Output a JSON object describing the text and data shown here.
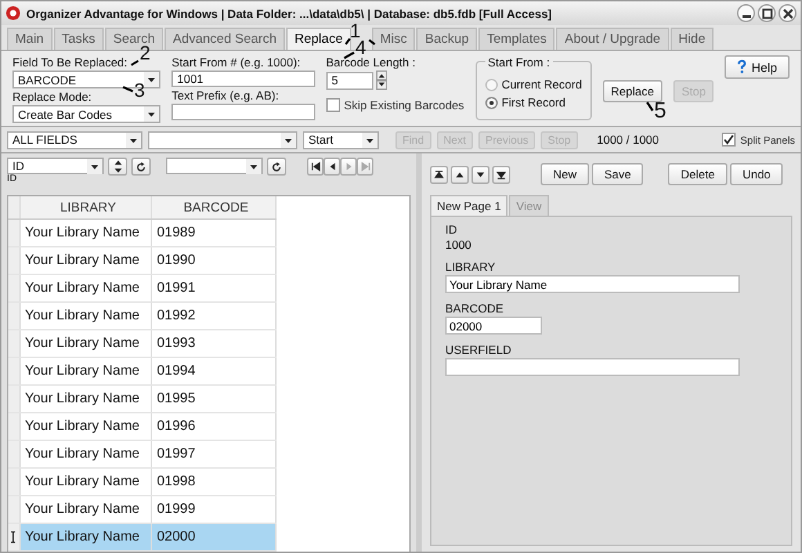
{
  "window": {
    "title": "Organizer Advantage for Windows | Data Folder: ...\\data\\db5\\ | Database: db5.fdb [Full Access]"
  },
  "tabs": [
    {
      "label": "Main",
      "selected": false
    },
    {
      "label": "Tasks",
      "selected": false
    },
    {
      "label": "Search",
      "selected": false
    },
    {
      "label": "Advanced Search",
      "selected": false
    },
    {
      "label": "Replace",
      "selected": true
    },
    {
      "label": "Misc",
      "selected": false
    },
    {
      "label": "Backup",
      "selected": false
    },
    {
      "label": "Templates",
      "selected": false
    },
    {
      "label": "About / Upgrade",
      "selected": false
    },
    {
      "label": "Hide",
      "selected": false
    }
  ],
  "replace_panel": {
    "field_label": "Field To Be Replaced:",
    "field_value": "BARCODE",
    "mode_label": "Replace Mode:",
    "mode_value": "Create Bar Codes",
    "start_label": "Start From # (e.g. 1000):",
    "start_value": "1001",
    "prefix_label": "Text Prefix (e.g. AB):",
    "length_label": "Barcode Length :",
    "length_value": "5",
    "skip_existing": {
      "label": "Skip Existing Barcodes",
      "checked": false
    },
    "start_from": {
      "title": "Start From :",
      "options": [
        {
          "label": "Current Record",
          "selected": false
        },
        {
          "label": "First Record",
          "selected": true
        }
      ]
    },
    "replace_button": {
      "label": "Replace",
      "disabled": false
    },
    "stop_button": {
      "label": "Stop",
      "disabled": true
    },
    "help_button": "Help"
  },
  "search_bar": {
    "field": "ALL FIELDS",
    "position": "Start",
    "buttons": [
      {
        "label": "Find",
        "disabled": true
      },
      {
        "label": "Next",
        "disabled": true
      },
      {
        "label": "Previous",
        "disabled": true
      },
      {
        "label": "Stop",
        "disabled": true
      }
    ],
    "count": "1000 / 1000",
    "split_panels": {
      "label": "Split Panels",
      "checked": true
    }
  },
  "grid": {
    "sort_field": "ID",
    "sort_caption": "ID",
    "columns": [
      "LIBRARY",
      "BARCODE"
    ],
    "rows": [
      {
        "library": "Your Library Name",
        "barcode": "01989",
        "selected": false
      },
      {
        "library": "Your Library Name",
        "barcode": "01990",
        "selected": false
      },
      {
        "library": "Your Library Name",
        "barcode": "01991",
        "selected": false
      },
      {
        "library": "Your Library Name",
        "barcode": "01992",
        "selected": false
      },
      {
        "library": "Your Library Name",
        "barcode": "01993",
        "selected": false
      },
      {
        "library": "Your Library Name",
        "barcode": "01994",
        "selected": false
      },
      {
        "library": "Your Library Name",
        "barcode": "01995",
        "selected": false
      },
      {
        "library": "Your Library Name",
        "barcode": "01996",
        "selected": false
      },
      {
        "library": "Your Library Name",
        "barcode": "01997",
        "selected": false
      },
      {
        "library": "Your Library Name",
        "barcode": "01998",
        "selected": false
      },
      {
        "library": "Your Library Name",
        "barcode": "01999",
        "selected": false
      },
      {
        "library": "Your Library Name",
        "barcode": "02000",
        "selected": true
      }
    ]
  },
  "record": {
    "buttons": [
      "New",
      "Save",
      "Delete",
      "Undo"
    ],
    "page_tabs": [
      {
        "label": "New Page 1",
        "selected": true
      },
      {
        "label": "View",
        "selected": false
      }
    ],
    "fields": [
      {
        "kind": "static",
        "label": "ID",
        "value": "1000"
      },
      {
        "kind": "input",
        "label": "LIBRARY",
        "value": "Your Library Name",
        "wide": true
      },
      {
        "kind": "input",
        "label": "BARCODE",
        "value": "02000",
        "wide": false
      },
      {
        "kind": "input",
        "label": "USERFIELD",
        "wide": true
      }
    ]
  },
  "annotations": [
    {
      "label": "1"
    },
    {
      "label": "2"
    },
    {
      "label": "3"
    },
    {
      "label": "4"
    },
    {
      "label": "5"
    }
  ]
}
